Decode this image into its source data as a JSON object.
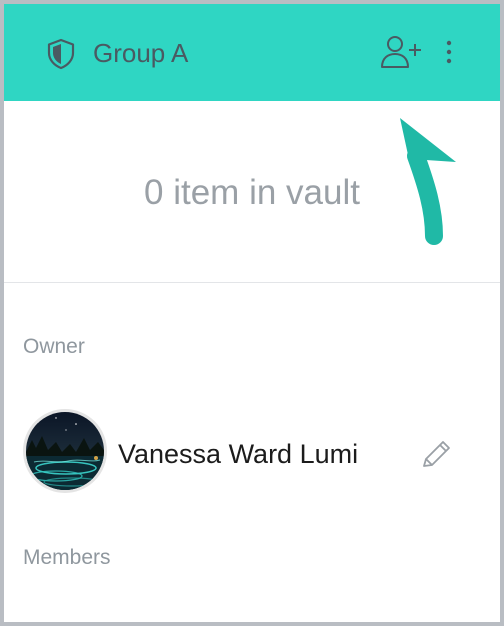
{
  "header": {
    "title": "Group A",
    "shield_icon": "shield-icon",
    "add_user_icon": "add-user-icon",
    "more_icon": "more-vertical-icon",
    "background": "#2fd6c3"
  },
  "vault": {
    "count_text": "0 item in vault"
  },
  "owner": {
    "label": "Owner",
    "name": "Vanessa Ward Lumi",
    "edit_icon": "pencil-icon"
  },
  "members": {
    "label": "Members"
  },
  "annotation": {
    "arrow_color": "#20b9a6"
  }
}
